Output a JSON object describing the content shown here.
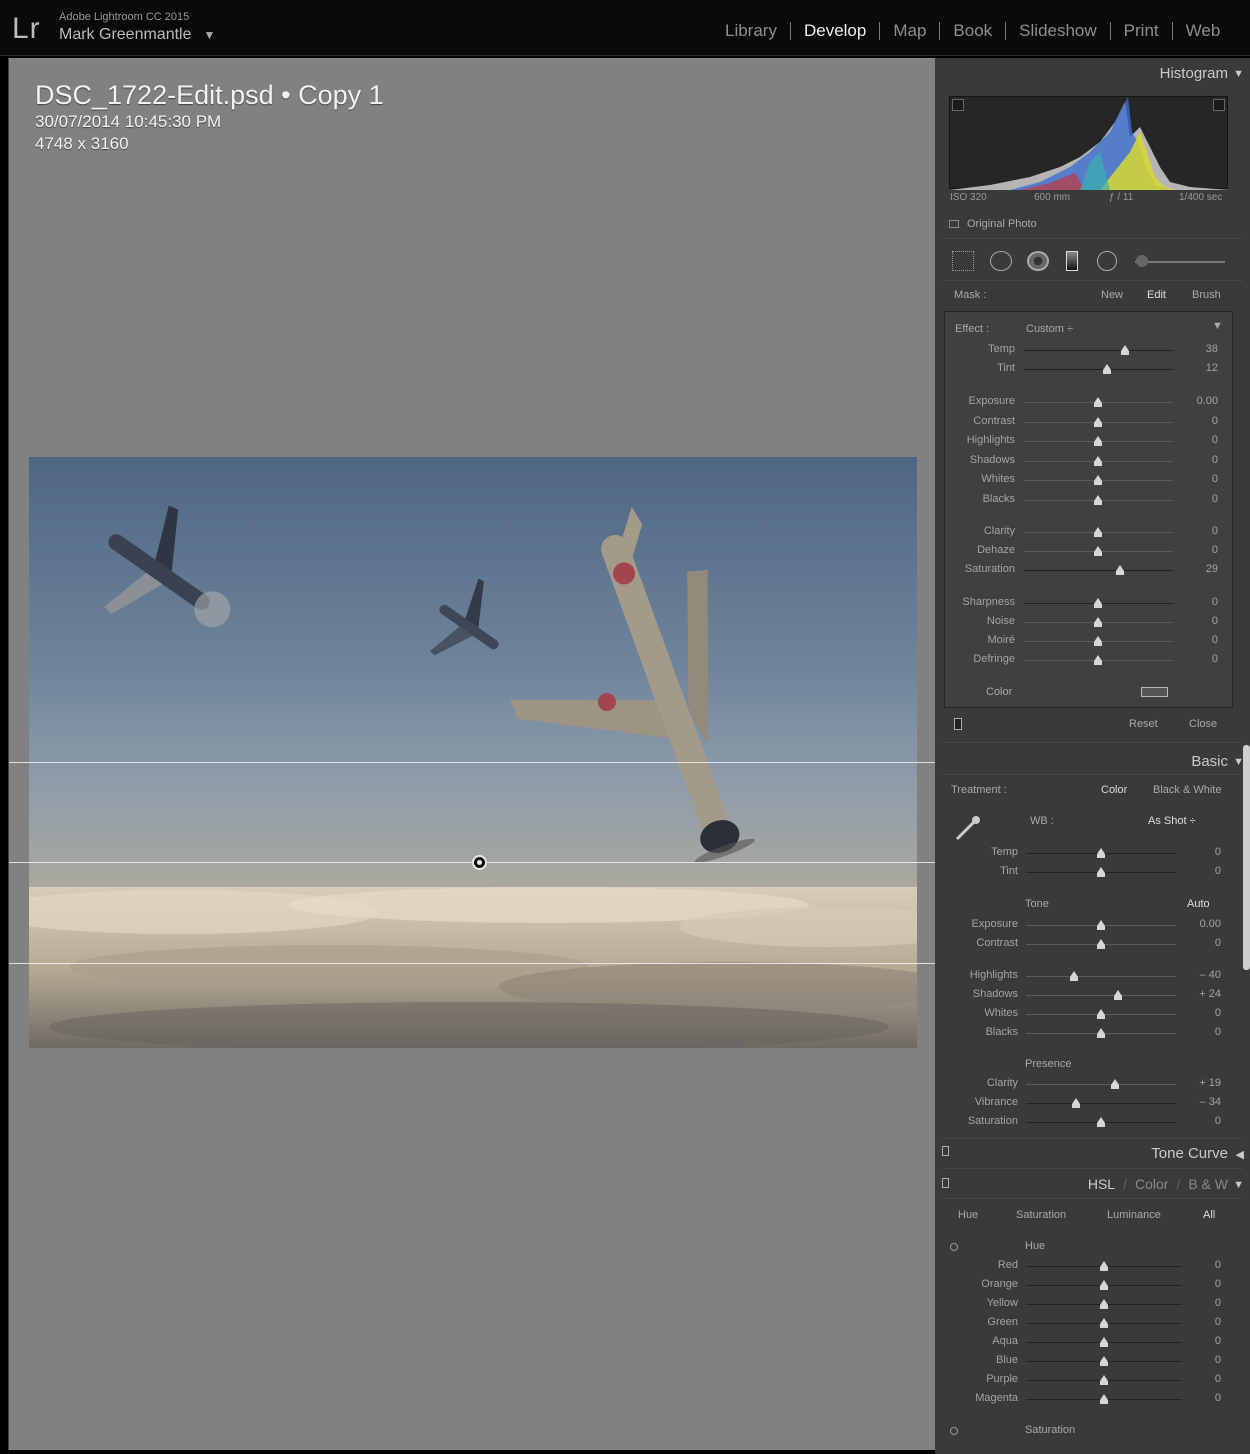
{
  "app": {
    "logo": "Lr",
    "name": "Adobe Lightroom CC 2015",
    "user": "Mark Greenmantle",
    "user_arrow": "▼"
  },
  "modules": [
    {
      "label": "Library",
      "active": false
    },
    {
      "label": "Develop",
      "active": true
    },
    {
      "label": "Map",
      "active": false
    },
    {
      "label": "Book",
      "active": false
    },
    {
      "label": "Slideshow",
      "active": false
    },
    {
      "label": "Print",
      "active": false
    },
    {
      "label": "Web",
      "active": false
    }
  ],
  "photo_info": {
    "title": "DSC_1722-Edit.psd  •  Copy 1",
    "date": "30/07/2014 10:45:30 PM",
    "dims": "4748 x 3160"
  },
  "histogram": {
    "title": "Histogram",
    "iso": "ISO 320",
    "focal": "600 mm",
    "aperture": "ƒ / 11",
    "shutter": "1/400 sec",
    "original_photo": "Original Photo"
  },
  "mask": {
    "label": "Mask :",
    "new": "New",
    "edit": "Edit",
    "brush": "Brush"
  },
  "effect": {
    "label": "Effect :",
    "preset": "Custom ÷",
    "wb": [
      {
        "name": "Temp",
        "value": "38",
        "pos": 0.68,
        "grad": "linear-gradient(90deg,#3a4fd0,#c9c93a)"
      },
      {
        "name": "Tint",
        "value": "12",
        "pos": 0.56,
        "grad": "linear-gradient(90deg,#3ec83e,#c83ec8)"
      }
    ],
    "tone": [
      {
        "name": "Exposure",
        "value": "0.00",
        "pos": 0.5
      },
      {
        "name": "Contrast",
        "value": "0",
        "pos": 0.5
      },
      {
        "name": "Highlights",
        "value": "0",
        "pos": 0.5
      },
      {
        "name": "Shadows",
        "value": "0",
        "pos": 0.5
      },
      {
        "name": "Whites",
        "value": "0",
        "pos": 0.5
      },
      {
        "name": "Blacks",
        "value": "0",
        "pos": 0.5
      }
    ],
    "presence": [
      {
        "name": "Clarity",
        "value": "0",
        "pos": 0.5
      },
      {
        "name": "Dehaze",
        "value": "0",
        "pos": 0.5
      },
      {
        "name": "Saturation",
        "value": "29",
        "pos": 0.645,
        "grad": "linear-gradient(90deg,#9a9a9a,#2f9a2f,#c03a3a,#5a3ad0)"
      }
    ],
    "detail": [
      {
        "name": "Sharpness",
        "value": "0",
        "pos": 0.5,
        "grad": "linear-gradient(90deg,#444,#c33)"
      },
      {
        "name": "Noise",
        "value": "0",
        "pos": 0.5
      },
      {
        "name": "Moiré",
        "value": "0",
        "pos": 0.5
      },
      {
        "name": "Defringe",
        "value": "0",
        "pos": 0.5
      }
    ],
    "color_label": "Color",
    "reset": "Reset",
    "close": "Close"
  },
  "basic": {
    "title": "Basic",
    "treatment_label": "Treatment :",
    "color": "Color",
    "bw": "Black & White",
    "wb_label": "WB :",
    "wb_value": "As Shot ÷",
    "wb": [
      {
        "name": "Temp",
        "value": "0",
        "pos": 0.5,
        "grad": "linear-gradient(90deg,#3a4fd0,#c9c93a)"
      },
      {
        "name": "Tint",
        "value": "0",
        "pos": 0.5,
        "grad": "linear-gradient(90deg,#3ec83e,#c83ec8)"
      }
    ],
    "tone_label": "Tone",
    "auto": "Auto",
    "tone": [
      {
        "name": "Exposure",
        "value": "0.00",
        "pos": 0.5
      },
      {
        "name": "Contrast",
        "value": "0",
        "pos": 0.5
      }
    ],
    "tone2": [
      {
        "name": "Highlights",
        "value": "– 40",
        "pos": 0.32
      },
      {
        "name": "Shadows",
        "value": "+ 24",
        "pos": 0.61
      },
      {
        "name": "Whites",
        "value": "0",
        "pos": 0.5
      },
      {
        "name": "Blacks",
        "value": "0",
        "pos": 0.5
      }
    ],
    "presence_label": "Presence",
    "presence": [
      {
        "name": "Clarity",
        "value": "+ 19",
        "pos": 0.595
      },
      {
        "name": "Vibrance",
        "value": "– 34",
        "pos": 0.33,
        "grad": "linear-gradient(90deg,#888,#3a9a3a,#c03a3a,#5a3ad0)"
      },
      {
        "name": "Saturation",
        "value": "0",
        "pos": 0.5,
        "grad": "linear-gradient(90deg,#888,#3a9a3a,#c03a3a,#5a3ad0)"
      }
    ]
  },
  "tonecurve": {
    "title": "Tone Curve"
  },
  "hsl": {
    "hsl": "HSL",
    "color": "Color",
    "bw": "B & W",
    "tabs": [
      "Hue",
      "Saturation",
      "Luminance",
      "All"
    ],
    "hue_label": "Hue",
    "saturation_label": "Saturation",
    "hue": [
      {
        "name": "Red",
        "value": "0",
        "pos": 0.5,
        "grad": "linear-gradient(90deg,#c03a8a,#c03a3a,#c0783a)"
      },
      {
        "name": "Orange",
        "value": "0",
        "pos": 0.5,
        "grad": "linear-gradient(90deg,#c03a3a,#c0903a,#c0c03a)"
      },
      {
        "name": "Yellow",
        "value": "0",
        "pos": 0.5,
        "grad": "linear-gradient(90deg,#c0783a,#c0c03a,#6ac03a)"
      },
      {
        "name": "Green",
        "value": "0",
        "pos": 0.5,
        "grad": "linear-gradient(90deg,#c0c03a,#3ac03a,#3ac0a0)"
      },
      {
        "name": "Aqua",
        "value": "0",
        "pos": 0.5,
        "grad": "linear-gradient(90deg,#3ac03a,#3ac0c0,#3a6ac0)"
      },
      {
        "name": "Blue",
        "value": "0",
        "pos": 0.5,
        "grad": "linear-gradient(90deg,#3ac0c0,#3a5ac0,#7a3ac0)"
      },
      {
        "name": "Purple",
        "value": "0",
        "pos": 0.5,
        "grad": "linear-gradient(90deg,#3a5ac0,#7a3ac0,#c03ac0)"
      },
      {
        "name": "Magenta",
        "value": "0",
        "pos": 0.5,
        "grad": "linear-gradient(90deg,#7a3ac0,#c03ac0,#c03a5a)"
      }
    ]
  }
}
